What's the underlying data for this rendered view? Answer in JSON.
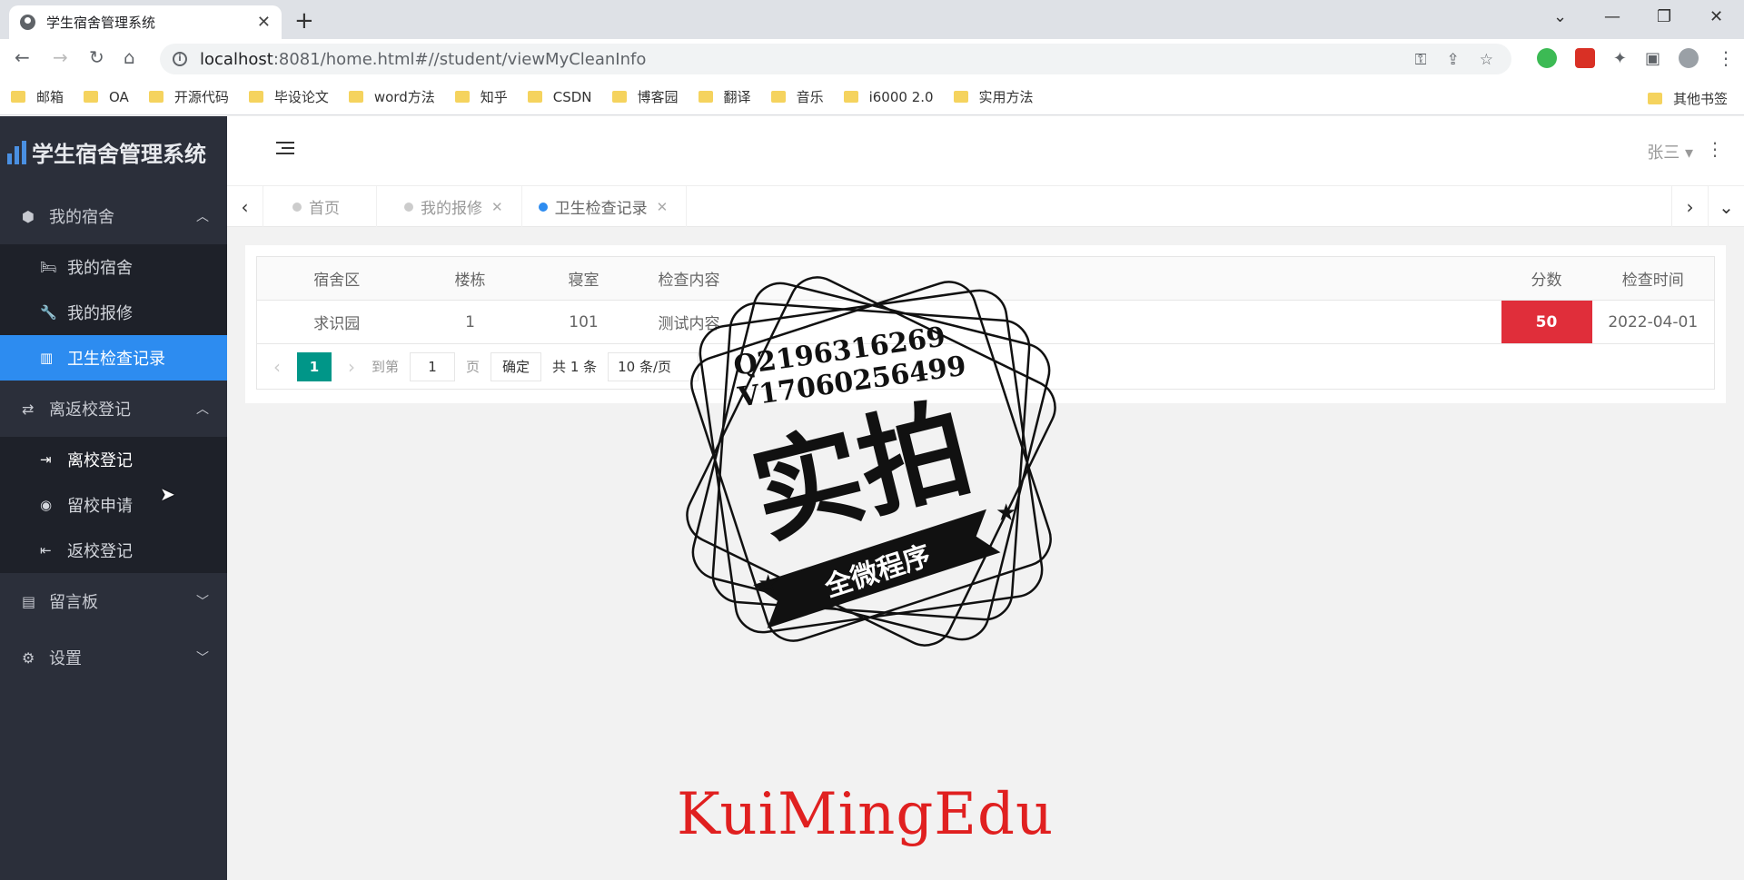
{
  "browser": {
    "tab_title": "学生宿舍管理系统",
    "tab_close": "✕",
    "new_tab": "+",
    "url_host": "localhost",
    "url_rest": ":8081/home.html#//student/viewMyCleanInfo",
    "bookmarks": [
      "邮箱",
      "OA",
      "开源代码",
      "毕设论文",
      "word方法",
      "知乎",
      "CSDN",
      "博客园",
      "翻译",
      "音乐",
      "i6000 2.0",
      "实用方法"
    ],
    "other_bookmarks": "其他书签"
  },
  "sidebar": {
    "logo_text": "学生宿舍管理系统",
    "groups": [
      {
        "label": "我的宿舍",
        "items": [
          "我的宿舍",
          "我的报修",
          "卫生检查记录"
        ]
      },
      {
        "label": "离返校登记",
        "items": [
          "离校登记",
          "留校申请",
          "返校登记"
        ]
      },
      {
        "label": "留言板"
      },
      {
        "label": "设置"
      }
    ]
  },
  "header": {
    "user": "张三"
  },
  "tabs": {
    "items": [
      {
        "label": "首页"
      },
      {
        "label": "我的报修"
      },
      {
        "label": "卫生检查记录"
      }
    ]
  },
  "table": {
    "headers": [
      "宿舍区",
      "楼栋",
      "寝室",
      "检查内容",
      "分数",
      "检查时间"
    ],
    "rows": [
      {
        "area": "求识园",
        "building": "1",
        "room": "101",
        "content": "测试内容",
        "score": "50",
        "time": "2022-04-01"
      }
    ]
  },
  "pager": {
    "current": "1",
    "goto_label": "到第",
    "goto_value": "1",
    "page_label": "页",
    "confirm": "确定",
    "total": "共 1 条",
    "page_size": "10 条/页"
  },
  "watermark": {
    "qq": "Q2196316269",
    "v": "V17060256499",
    "big": "实拍",
    "ribbon": "全微程序",
    "brand": "KuiMingEdu"
  }
}
